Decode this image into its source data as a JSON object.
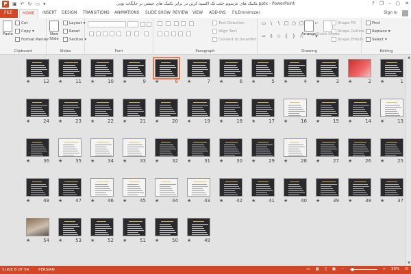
{
  "titlebar": {
    "app_letter": "P",
    "title": "تکنیک های عرسوم جلب تک اکسید کربن در برابر تکنیک های جیشن بر جایگات بونی.pptx - PowerPoint",
    "min": "–",
    "max": "▢",
    "close": "✕",
    "help": "?",
    "restore": "❐"
  },
  "tabs": {
    "file": "FILE",
    "home": "HOME",
    "insert": "INSERT",
    "design": "DESIGN",
    "transitions": "TRANSITIONS",
    "animations": "ANIMATIONS",
    "slideshow": "SLIDE SHOW",
    "review": "REVIEW",
    "view": "VIEW",
    "addins": "ADD-INS",
    "fileminimizer": "FILEminimizer",
    "signin": "Sign in"
  },
  "ribbon": {
    "clipboard": {
      "label": "Clipboard",
      "paste": "Paste",
      "cut": "Cut",
      "copy": "Copy",
      "format_painter": "Format Painter"
    },
    "slides": {
      "label": "Slides",
      "new_slide": "New",
      "new_slide2": "Slide",
      "layout": "Layout",
      "reset": "Reset",
      "section": "Section"
    },
    "font": {
      "label": "Font"
    },
    "paragraph": {
      "label": "Paragraph",
      "text_direction": "Text Direction",
      "align_text": "Align Text",
      "convert_smartart": "Convert to SmartArt"
    },
    "drawing": {
      "label": "Drawing",
      "arrange": "Arrange",
      "quick_styles": "Quick Styles",
      "shape_fill": "Shape Fill",
      "shape_outline": "Shape Outline",
      "shape_effects": "Shape Effects"
    },
    "editing": {
      "label": "Editing",
      "find": "Find",
      "replace": "Replace",
      "select": "Select"
    }
  },
  "sorter": {
    "selected_slide": 8,
    "star": "★",
    "rows": [
      [
        12,
        11,
        10,
        9,
        8,
        7,
        6,
        5,
        4,
        3,
        2,
        1
      ],
      [
        24,
        23,
        22,
        21,
        20,
        19,
        18,
        17,
        16,
        15,
        14,
        13
      ],
      [
        36,
        35,
        34,
        33,
        32,
        31,
        30,
        29,
        28,
        27,
        26,
        25
      ],
      [
        48,
        47,
        46,
        45,
        44,
        43,
        42,
        41,
        40,
        39,
        38,
        37
      ],
      [
        54,
        53,
        52,
        51,
        50,
        49
      ]
    ],
    "cover_slides": [
      2
    ],
    "photo_slides": [
      54
    ],
    "light_slides": [
      13,
      16,
      35,
      34,
      33,
      28,
      44,
      45,
      46,
      43
    ]
  },
  "statusbar": {
    "slide_info": "SLIDE 8 OF 54",
    "language": "PERSIAN",
    "zoom": "30%",
    "zoom_minus": "−",
    "zoom_plus": "+"
  },
  "colors": {
    "accent": "#d24726",
    "selection": "#e07a4f"
  }
}
